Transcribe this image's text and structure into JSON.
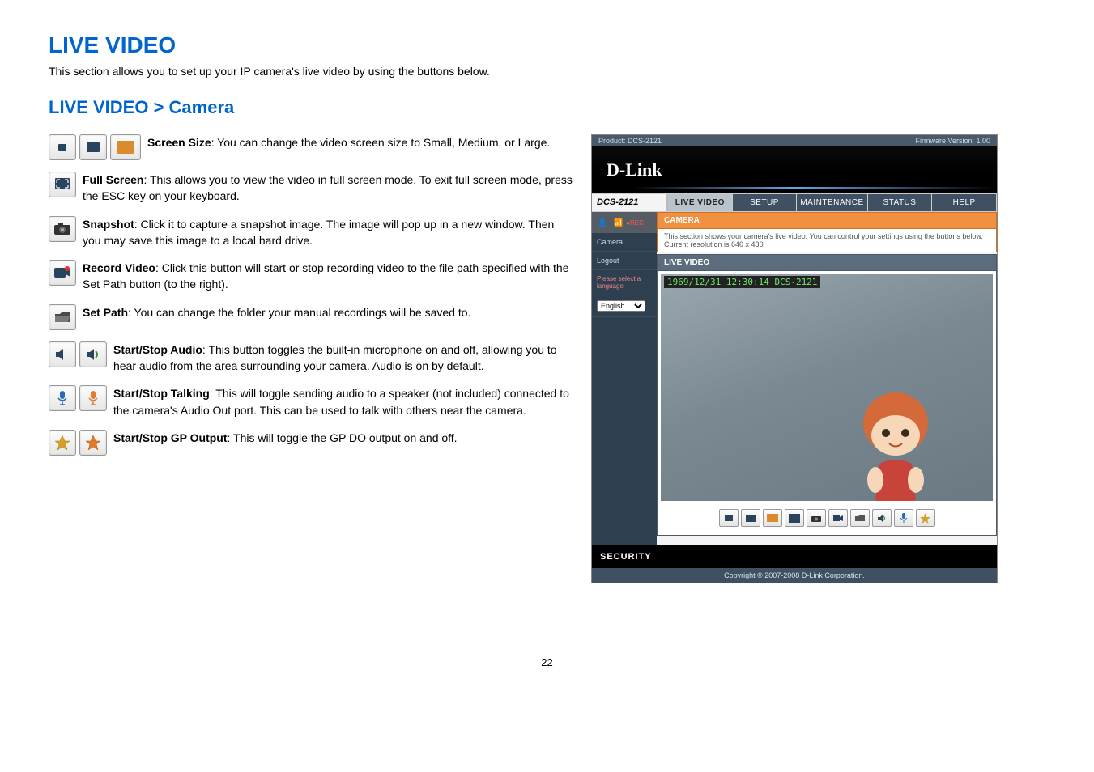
{
  "page_title": "LIVE VIDEO",
  "intro": "This section allows you to set up your IP camera's live video by using the buttons below.",
  "subheading": "LIVE VIDEO > Camera",
  "items": {
    "screen_size": {
      "label": "Screen Size",
      "text": ":  You can change the video screen size to Small, Medium, or Large."
    },
    "full_screen": {
      "label": "Full Screen",
      "text": ":  This allows you to view the video in full screen mode. To exit full screen mode, press the ESC key on your keyboard."
    },
    "snapshot": {
      "label": "Snapshot",
      "text": ": Click it to capture a snapshot image. The image will pop up in a new window. Then you may save this image to a local hard drive."
    },
    "record_video": {
      "label": "Record Video",
      "text": ":   Click this button will start or stop recording video to the file path specified with the Set Path button (to the right)."
    },
    "set_path": {
      "label": "Set Path",
      "text": ":  You can change the folder your manual recordings will be saved to."
    },
    "start_stop_audio": {
      "label": "Start/Stop Audio",
      "text": ":   This button toggles the built-in microphone on and off, allowing you to hear audio from the area surrounding your camera. Audio is on by default."
    },
    "start_stop_talking": {
      "label": "Start/Stop Talking",
      "text": ":  This will toggle sending audio to a speaker (not included) connected to the camera's Audio Out port. This can be used to talk with others near the camera."
    },
    "start_stop_gp": {
      "label": "Start/Stop GP Output",
      "text": ":  This will toggle the GP DO output on and off."
    }
  },
  "page_number": "22",
  "shot": {
    "product": "Product: DCS-2121",
    "firmware": "Firmware Version: 1.00",
    "brand": "D-Link",
    "model": "DCS-2121",
    "tabs": {
      "live": "LIVE VIDEO",
      "setup": "SETUP",
      "maint": "MAINTENANCE",
      "status": "STATUS",
      "help": "HELP"
    },
    "side": {
      "camera": "Camera",
      "logout": "Logout",
      "sel_lang": "Please select a language",
      "english": "English"
    },
    "cam_header": "CAMERA",
    "cam_desc": "This section shows your camera's live video. You can control your settings using the buttons below. Current resolution is 640 x 480",
    "lv_header": "LIVE VIDEO",
    "osd": "1969/12/31 12:30:14 DCS-2121",
    "security": "SECURITY",
    "copyright": "Copyright © 2007-2008 D-Link Corporation."
  }
}
